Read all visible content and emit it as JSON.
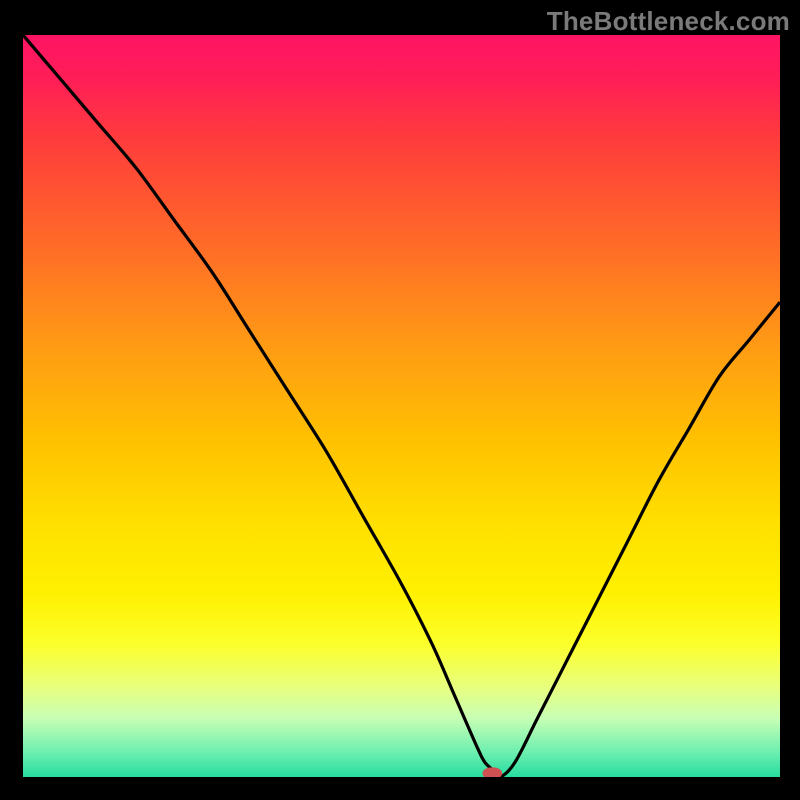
{
  "watermark": {
    "text": "TheBottleneck.com"
  },
  "chart_data": {
    "type": "line",
    "title": "",
    "xlabel": "",
    "ylabel": "",
    "xlim": [
      0,
      100
    ],
    "ylim": [
      0,
      100
    ],
    "grid": false,
    "legend": false,
    "series": [
      {
        "name": "curve",
        "x": [
          0,
          5,
          10,
          15,
          20,
          25,
          30,
          35,
          40,
          45,
          50,
          54,
          57,
          60,
          61,
          62,
          63,
          65,
          68,
          72,
          76,
          80,
          84,
          88,
          92,
          96,
          100
        ],
        "y": [
          100,
          94,
          88,
          82,
          75,
          68,
          60,
          52,
          44,
          35,
          26,
          18,
          11,
          4,
          2,
          1,
          0,
          2,
          8,
          16,
          24,
          32,
          40,
          47,
          54,
          59,
          64
        ]
      }
    ],
    "marker": {
      "x": 62,
      "y": 0.5,
      "shape": "pill",
      "color": "#cf5151"
    },
    "background_gradient": {
      "direction": "vertical",
      "stops": [
        {
          "pos": 0.0,
          "color": "#ff1464"
        },
        {
          "pos": 0.14,
          "color": "#ff3c3c"
        },
        {
          "pos": 0.42,
          "color": "#ff9b14"
        },
        {
          "pos": 0.66,
          "color": "#ffe000"
        },
        {
          "pos": 0.88,
          "color": "#e8ff80"
        },
        {
          "pos": 1.0,
          "color": "#26dca0"
        }
      ]
    }
  }
}
